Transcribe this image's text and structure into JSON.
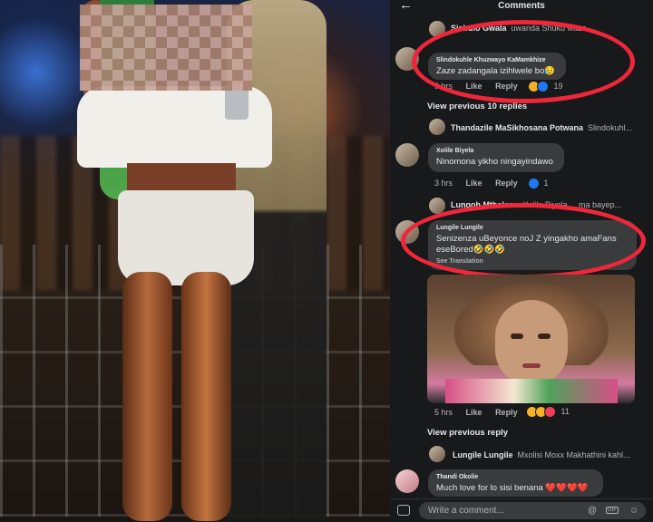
{
  "header": {
    "title": "Comments",
    "back_glyph": "←"
  },
  "comments": [
    {
      "author": "Sjabulo Gwala",
      "text": "uwanda Shuku waze ..."
    },
    {
      "author": "Slindokuhle Khuzwayo KaMamkhize",
      "text": "Zaze zadangala izihlwele bo😥",
      "time": "9 hrs",
      "like": "Like",
      "reply": "Reply",
      "count": "19"
    },
    {
      "author": "Thandazile MaSikhosana Potwana",
      "text": "Slindokuhl..."
    },
    {
      "author": "Xolile Biyela",
      "text": "Ninomona yikho ningayindawo",
      "time": "3 hrs",
      "like": "Like",
      "reply": "Reply",
      "count": "1"
    },
    {
      "author": "Lungoh Mthalane",
      "text": "Xolile Biyela ... ma bayep..."
    },
    {
      "author": "Lungile Lungile",
      "text": "Senizenza uBeyonce noJ Z yingakho amaFans eseBored🤣🤣🤣",
      "translate": "See Translation",
      "time": "5 hrs",
      "like": "Like",
      "reply": "Reply",
      "count": "11"
    },
    {
      "author": "Lungile Lungile",
      "text": "Mxolisi Moxx Makhathini kahl..."
    },
    {
      "author": "Thandi Okolie",
      "text": "Much love for lo sisi benana ❤️❤️❤️❤️"
    }
  ],
  "links": {
    "view_previous_replies": "View previous 10 replies",
    "view_previous_reply": "View previous reply"
  },
  "composer": {
    "placeholder": "Write a comment...",
    "gif_label": "GIF"
  },
  "colors": {
    "background": "#18191a",
    "bubble": "#3a3b3c",
    "highlight": "#f0263a"
  }
}
